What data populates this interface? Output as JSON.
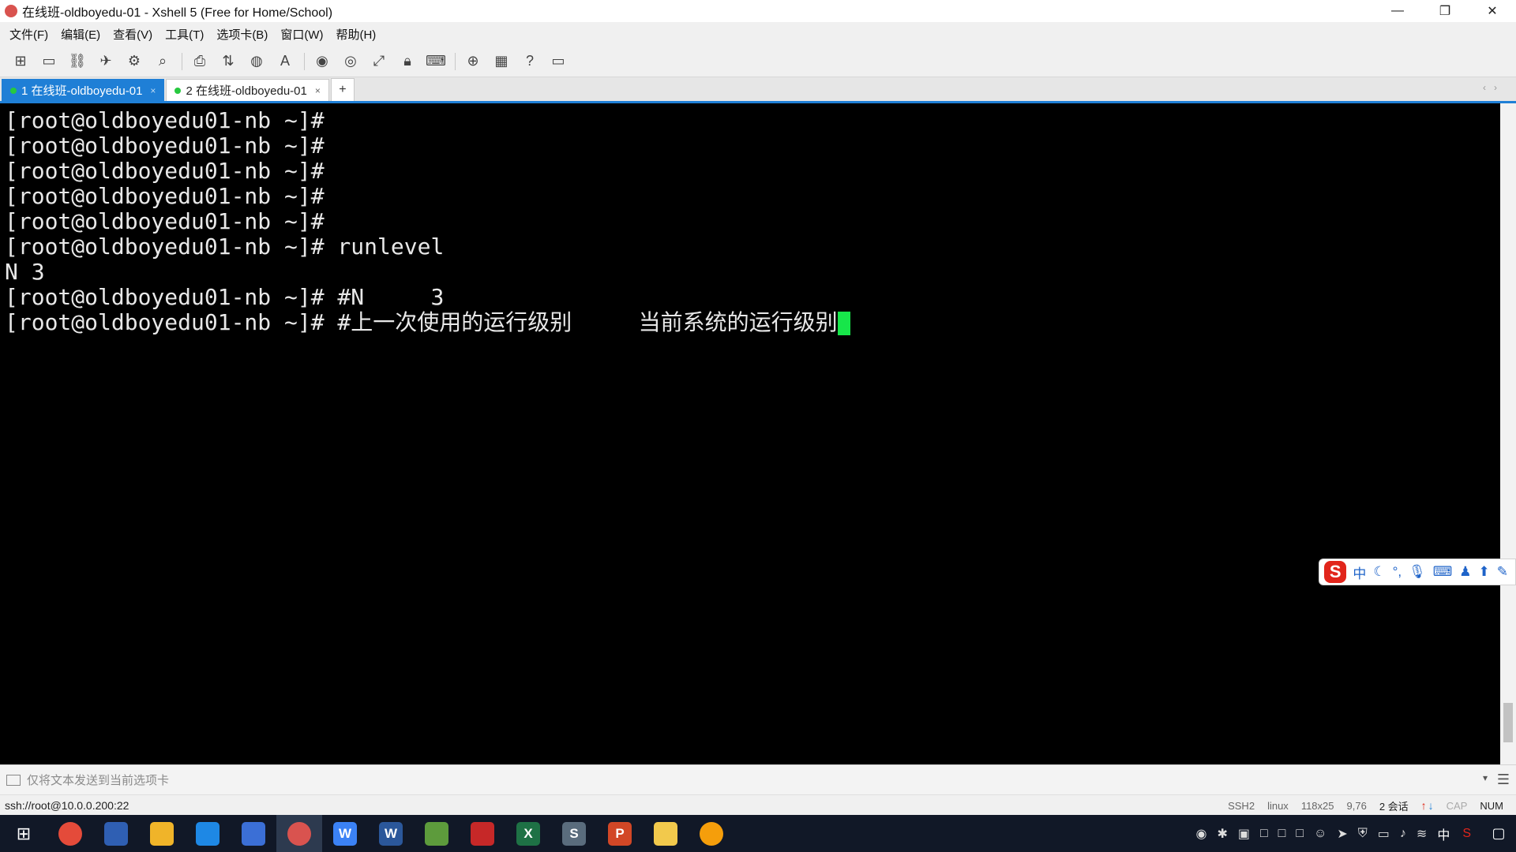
{
  "window": {
    "title": "在线班-oldboyedu-01 - Xshell 5 (Free for Home/School)"
  },
  "window_controls": {
    "minimize": "—",
    "restore": "❐",
    "close": "✕"
  },
  "menu": [
    "文件(F)",
    "编辑(E)",
    "查看(V)",
    "工具(T)",
    "选项卡(B)",
    "窗口(W)",
    "帮助(H)"
  ],
  "toolbar_icons": [
    "new-session",
    "open",
    "reconnect",
    "xftp",
    "find",
    "print",
    "transfer",
    "globe",
    "font",
    "script-record",
    "script-stop",
    "fullscreen",
    "lock",
    "keyboard",
    "add",
    "layout",
    "help",
    "chat"
  ],
  "tabs": [
    {
      "label": "1 在线班-oldboyedu-01",
      "active": true
    },
    {
      "label": "2 在线班-oldboyedu-01",
      "active": false
    }
  ],
  "tab_add": "+",
  "terminal": {
    "lines": [
      "[root@oldboyedu01-nb ~]#",
      "[root@oldboyedu01-nb ~]#",
      "[root@oldboyedu01-nb ~]#",
      "[root@oldboyedu01-nb ~]#",
      "[root@oldboyedu01-nb ~]#",
      "[root@oldboyedu01-nb ~]# runlevel",
      "N 3",
      "[root@oldboyedu01-nb ~]# #N     3",
      "[root@oldboyedu01-nb ~]# #上一次使用的运行级别     当前系统的运行级别"
    ],
    "cursor_color": "#17e64a"
  },
  "ime": {
    "logo": "S",
    "lang": "中"
  },
  "input_bar": {
    "placeholder": "仅将文本发送到当前选项卡"
  },
  "status": {
    "connection": "ssh://root@10.0.0.200:22",
    "protocol": "SSH2",
    "term": "linux",
    "size": "118x25",
    "pos": "9,76",
    "sessions": "2 会话",
    "cap": "CAP",
    "num": "NUM"
  },
  "taskbar": {
    "apps": [
      {
        "name": "chrome",
        "letter": "",
        "color": "#e44b3a",
        "active": false
      },
      {
        "name": "save",
        "letter": "",
        "color": "#2f5fb3",
        "active": false
      },
      {
        "name": "explorer",
        "letter": "",
        "color": "#f0b429",
        "active": false
      },
      {
        "name": "store",
        "letter": "",
        "color": "#1e88e5",
        "active": false
      },
      {
        "name": "pen",
        "letter": "",
        "color": "#3b6fd6",
        "active": false
      },
      {
        "name": "xshell",
        "letter": "",
        "color": "#d9534f",
        "active": true
      },
      {
        "name": "writer",
        "letter": "W",
        "color": "#3b82f6",
        "active": false
      },
      {
        "name": "word",
        "letter": "W",
        "color": "#2b579a",
        "active": false
      },
      {
        "name": "sheet",
        "letter": "",
        "color": "#5d9b3c",
        "active": false
      },
      {
        "name": "flash",
        "letter": "",
        "color": "#c62828",
        "active": false
      },
      {
        "name": "excel",
        "letter": "X",
        "color": "#1e7145",
        "active": false
      },
      {
        "name": "sublime",
        "letter": "S",
        "color": "#5a6c7d",
        "active": false
      },
      {
        "name": "powerpoint",
        "letter": "P",
        "color": "#d24726",
        "active": false
      },
      {
        "name": "notes",
        "letter": "",
        "color": "#f2c94c",
        "active": false
      },
      {
        "name": "cat",
        "letter": "",
        "color": "#f59e0b",
        "active": false
      }
    ],
    "tray_lang": "中"
  }
}
